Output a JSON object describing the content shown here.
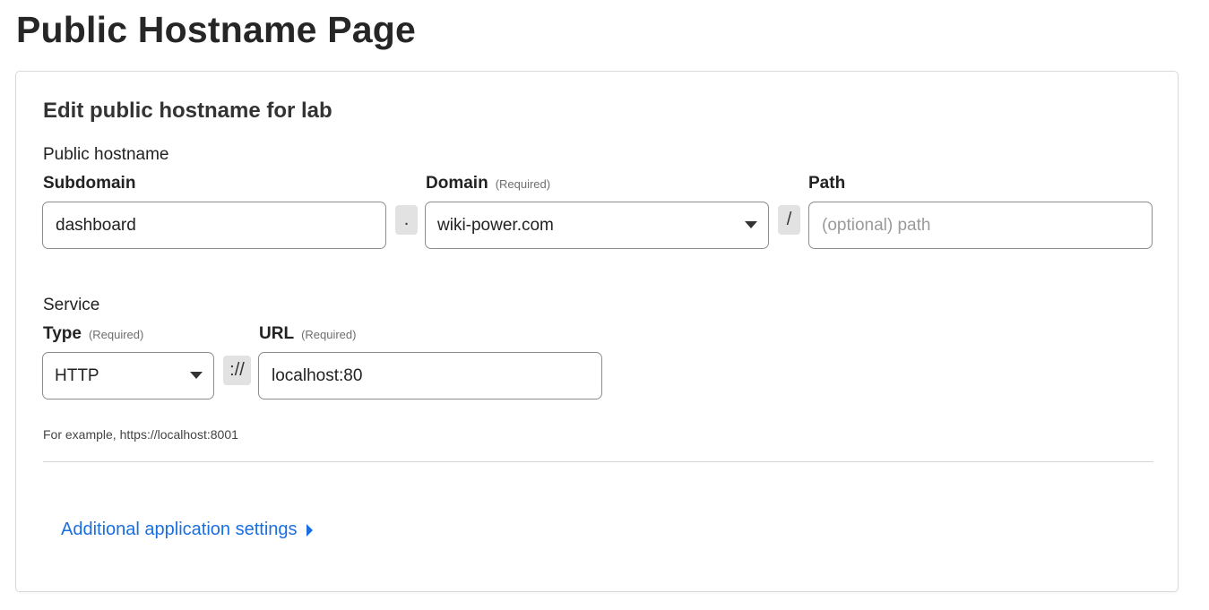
{
  "page": {
    "title": "Public Hostname Page"
  },
  "card": {
    "title": "Edit public hostname for lab",
    "public_hostname": {
      "section_label": "Public hostname",
      "subdomain": {
        "label": "Subdomain",
        "value": "dashboard",
        "placeholder": ""
      },
      "dot_separator": ".",
      "domain": {
        "label": "Domain",
        "required_hint": "(Required)",
        "selected": "wiki-power.com",
        "icon": "chevron-down-icon"
      },
      "slash_separator": "/",
      "path": {
        "label": "Path",
        "value": "",
        "placeholder": "(optional) path"
      }
    },
    "service": {
      "section_label": "Service",
      "type": {
        "label": "Type",
        "required_hint": "(Required)",
        "selected": "HTTP",
        "icon": "chevron-down-icon"
      },
      "scheme_separator": "://",
      "url": {
        "label": "URL",
        "required_hint": "(Required)",
        "value": "localhost:80",
        "placeholder": ""
      },
      "help_text": "For example, https://localhost:8001"
    },
    "additional_settings_link": {
      "label": "Additional application settings",
      "icon": "caret-right-icon"
    }
  },
  "colors": {
    "link": "#1a6fe0",
    "border": "#8c8c8c",
    "separator_bg": "#e2e2e2"
  }
}
